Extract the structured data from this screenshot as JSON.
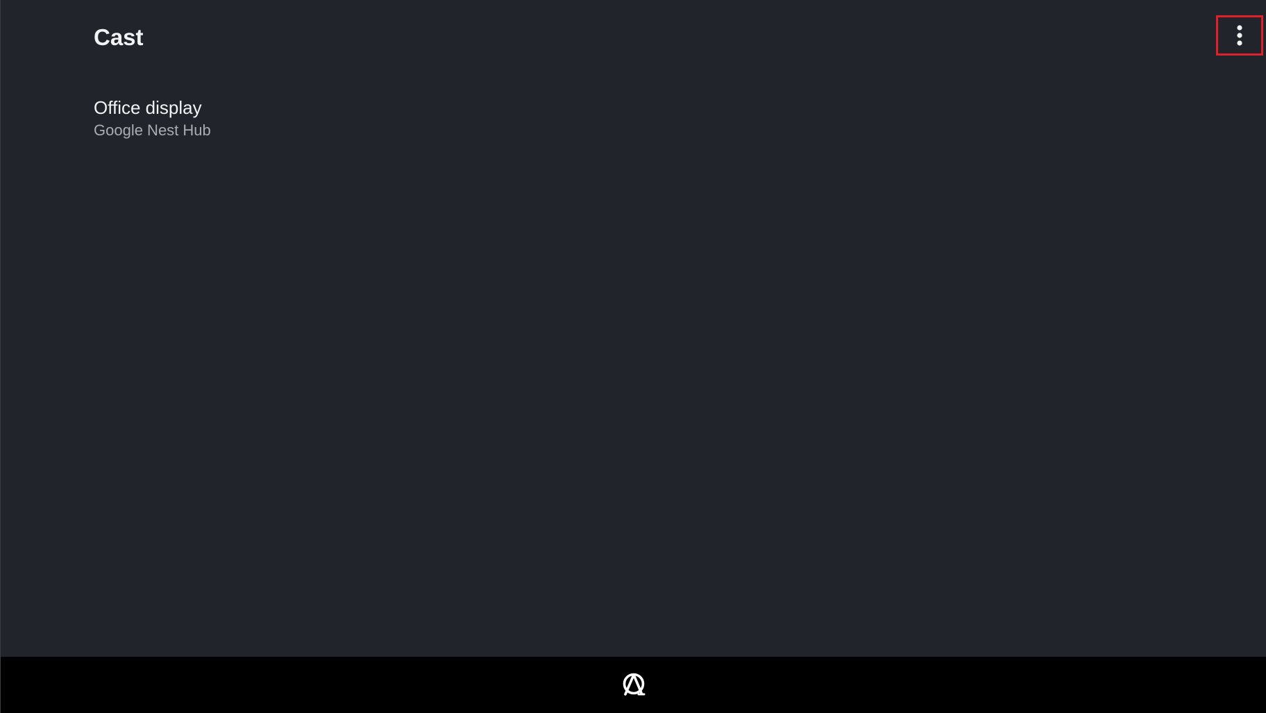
{
  "header": {
    "title": "Cast",
    "overflow_menu_icon": "more-vert-icon"
  },
  "devices": [
    {
      "name": "Office display",
      "model": "Google Nest Hub"
    }
  ],
  "nav_bar": {
    "home_icon": "launcher-logo-icon"
  },
  "colors": {
    "background": "#21252b",
    "nav_bar": "#000000",
    "primary_text": "#f1f3f4",
    "secondary_text": "#a8adb3",
    "highlight": "#e0202b"
  }
}
